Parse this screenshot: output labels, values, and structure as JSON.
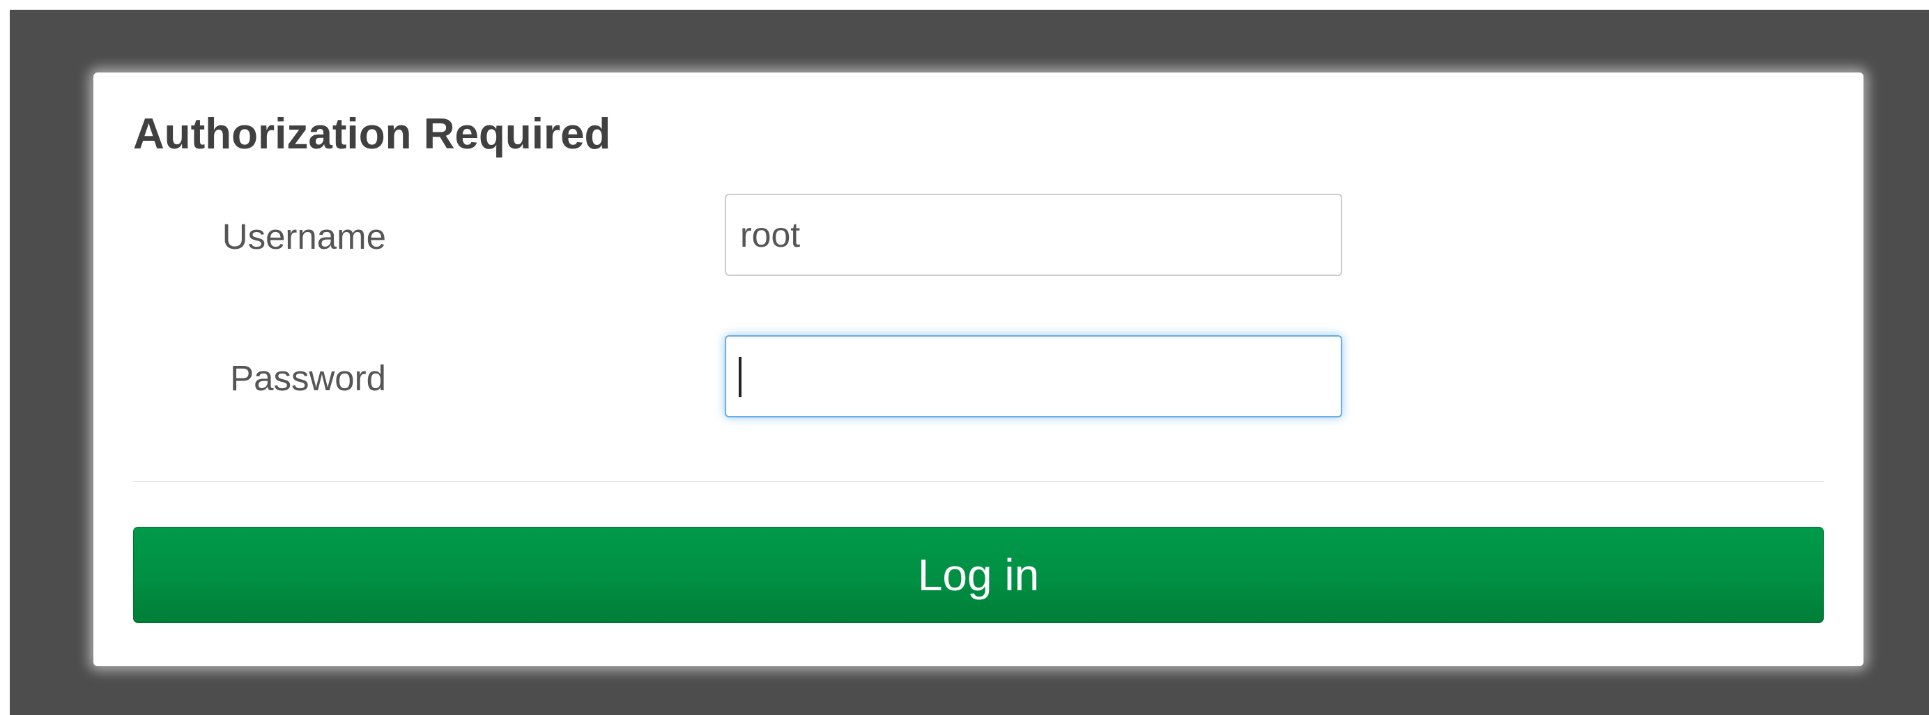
{
  "dialog": {
    "title": "Authorization Required",
    "username": {
      "label": "Username",
      "value": "root"
    },
    "password": {
      "label": "Password",
      "value": ""
    },
    "submit_label": "Log in"
  },
  "colors": {
    "backdrop": "#4d4d4d",
    "button": "#008f43",
    "focus_border": "#66afe9"
  }
}
